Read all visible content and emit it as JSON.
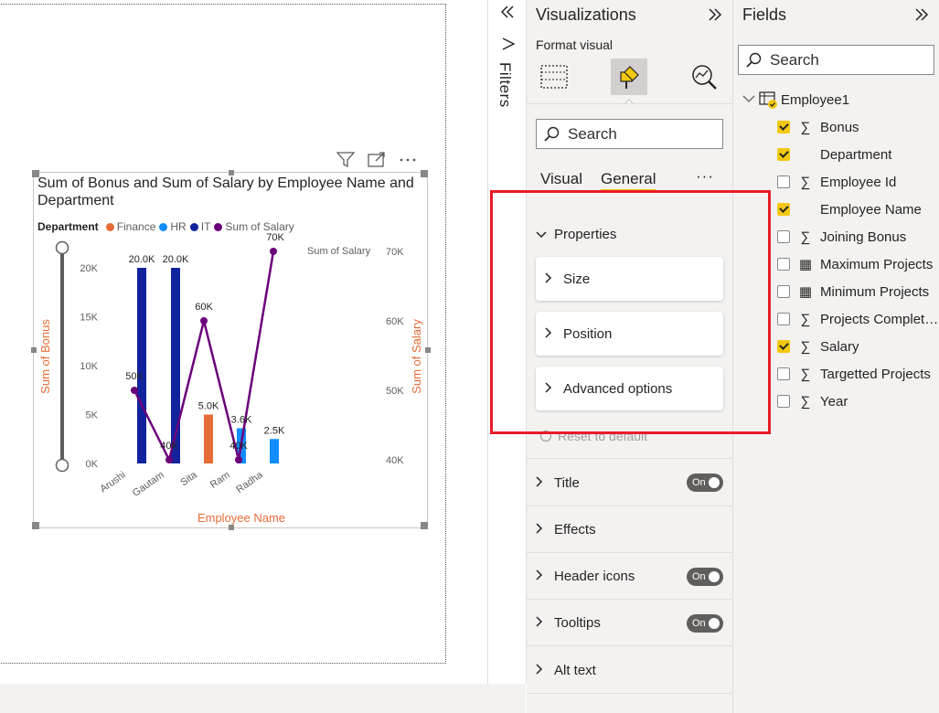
{
  "visual": {
    "title": "Sum of Bonus and Sum of Salary by Employee Name and Department",
    "legend": {
      "title": "Department",
      "items": [
        {
          "label": "Finance",
          "color": "#e66c37"
        },
        {
          "label": "HR",
          "color": "#118dff"
        },
        {
          "label": "IT",
          "color": "#12239e"
        },
        {
          "label": "Sum of Salary",
          "color": "#6b007b"
        }
      ]
    },
    "toolbar_icons": [
      "filter-icon",
      "focus-mode-icon",
      "more-options-icon"
    ]
  },
  "chart_data": {
    "type": "bar",
    "categories": [
      "Arushi",
      "Gautam",
      "Sita",
      "Ram",
      "Radha"
    ],
    "series": [
      {
        "name": "Finance",
        "color": "#e66c37",
        "values": [
          null,
          null,
          5000,
          null,
          null
        ]
      },
      {
        "name": "HR",
        "color": "#118dff",
        "values": [
          null,
          null,
          null,
          3600,
          2500
        ]
      },
      {
        "name": "IT",
        "color": "#12239e",
        "values": [
          20000,
          20000,
          null,
          null,
          null
        ]
      },
      {
        "name": "Sum of Salary",
        "color": "#6b007b",
        "type": "line",
        "axis": "right",
        "values": [
          50000,
          40000,
          60000,
          40000,
          70000
        ]
      }
    ],
    "data_labels": {
      "bars": [
        "20.0K",
        "20.0K",
        "5.0K",
        "3.6K",
        "2.5K"
      ],
      "line": [
        "50K",
        "40K",
        "60K",
        "40K",
        "70K"
      ]
    },
    "xlabel": "Employee Name",
    "ylabel": "Sum of Bonus",
    "y2label": "Sum of Salary",
    "y2_header": "Sum of Salary",
    "ylim": [
      0,
      20000
    ],
    "y2lim": [
      40000,
      70000
    ],
    "y_ticks": [
      "0K",
      "5K",
      "10K",
      "15K",
      "20K"
    ],
    "y2_ticks": [
      "40K",
      "50K",
      "60K",
      "70K"
    ],
    "legend_position": "top-left"
  },
  "filters": {
    "label": "Filters"
  },
  "visualizations": {
    "title": "Visualizations",
    "format_label": "Format visual",
    "search_placeholder": "Search",
    "tabs": [
      "Visual",
      "General"
    ],
    "more": "···",
    "properties_label": "Properties",
    "cards": [
      "Size",
      "Position",
      "Advanced options"
    ],
    "reset_label": "Reset to default",
    "sections": [
      {
        "label": "Title",
        "toggle": "On"
      },
      {
        "label": "Effects",
        "toggle": null
      },
      {
        "label": "Header icons",
        "toggle": "On"
      },
      {
        "label": "Tooltips",
        "toggle": "On"
      },
      {
        "label": "Alt text",
        "toggle": null
      }
    ]
  },
  "fields": {
    "title": "Fields",
    "search_placeholder": "Search",
    "table": "Employee1",
    "items": [
      {
        "label": "Bonus",
        "checked": true,
        "icon": "sigma"
      },
      {
        "label": "Department",
        "checked": true,
        "icon": ""
      },
      {
        "label": "Employee Id",
        "checked": false,
        "icon": "sigma"
      },
      {
        "label": "Employee Name",
        "checked": true,
        "icon": ""
      },
      {
        "label": "Joining Bonus",
        "checked": false,
        "icon": "sigma"
      },
      {
        "label": "Maximum Projects",
        "checked": false,
        "icon": "calculator"
      },
      {
        "label": "Minimum Projects",
        "checked": false,
        "icon": "calculator"
      },
      {
        "label": "Projects Complet…",
        "checked": false,
        "icon": "sigma"
      },
      {
        "label": "Salary",
        "checked": true,
        "icon": "sigma"
      },
      {
        "label": "Targetted Projects",
        "checked": false,
        "icon": "sigma"
      },
      {
        "label": "Year",
        "checked": false,
        "icon": "sigma"
      }
    ]
  },
  "highlight_color": "#e81c27"
}
